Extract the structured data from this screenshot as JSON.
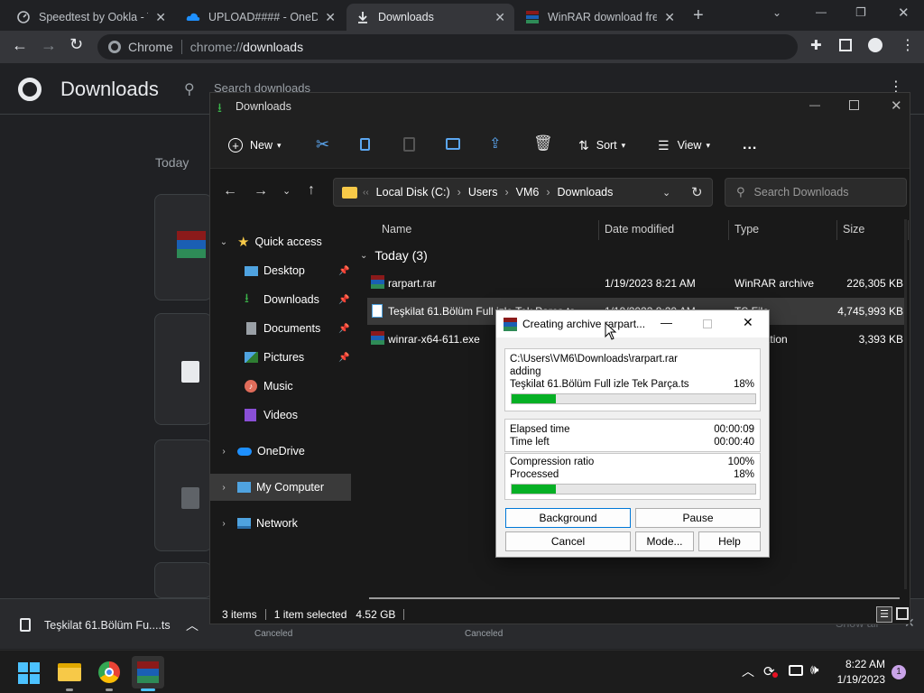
{
  "tabs": [
    {
      "title": "Speedtest by Ookla - Th",
      "icon": "speedtest-icon",
      "color": "#bdc1c6"
    },
    {
      "title": "UPLOAD#### - OneDri",
      "icon": "onedrive-icon",
      "color": "#1e90ff"
    },
    {
      "title": "Downloads",
      "icon": "download-icon",
      "color": "#e8eaed"
    },
    {
      "title": "WinRAR download free",
      "icon": "winrar-icon",
      "color": "#8b1a1a"
    }
  ],
  "omnibox": {
    "site": "Chrome",
    "url_prefix": "chrome://",
    "url_path": "downloads"
  },
  "downloads_page": {
    "title": "Downloads",
    "search_placeholder": "Search downloads",
    "section": "Today",
    "show_all": "Show all"
  },
  "shelf": {
    "file": "Teşkilat 61.Bölüm Fu....ts",
    "item1_status": "Canceled",
    "item2_status": "Canceled"
  },
  "explorer": {
    "title": "Downloads",
    "cmd": {
      "new": "New",
      "sort": "Sort",
      "view": "View",
      "more": "..."
    },
    "breadcrumb": [
      "Local Disk (C:)",
      "Users",
      "VM6",
      "Downloads"
    ],
    "search_placeholder": "Search Downloads",
    "nav": {
      "quick_access": "Quick access",
      "items": [
        "Desktop",
        "Downloads",
        "Documents",
        "Pictures",
        "Music",
        "Videos"
      ],
      "onedrive": "OneDrive",
      "my_computer": "My Computer",
      "network": "Network"
    },
    "columns": {
      "name": "Name",
      "date": "Date modified",
      "type": "Type",
      "size": "Size"
    },
    "group": "Today (3)",
    "files": [
      {
        "name": "rarpart.rar",
        "date": "1/19/2023 8:21 AM",
        "type": "WinRAR archive",
        "size": "226,305 KB"
      },
      {
        "name": "Teşkilat 61.Bölüm Full izle Tek Parça.ts",
        "date": "1/19/2023 8:20 AM",
        "type": "TS File",
        "size": "4,745,993 KB"
      },
      {
        "name": "winrar-x64-611.exe",
        "date": "",
        "type": "Application",
        "size": "3,393 KB"
      }
    ],
    "status": {
      "count": "3 items",
      "selected": "1 item selected",
      "size": "4.52 GB"
    }
  },
  "winrar": {
    "title": "Creating archive rarpart...",
    "archive_path": "C:\\Users\\VM6\\Downloads\\rarpart.rar",
    "action": "adding",
    "current_file": "Teşkilat 61.Bölüm Full izle Tek Parça.ts",
    "file_percent": "18%",
    "file_progress": 0.18,
    "elapsed_label": "Elapsed time",
    "elapsed": "00:00:09",
    "left_label": "Time left",
    "left": "00:00:40",
    "ratio_label": "Compression ratio",
    "ratio": "100%",
    "processed_label": "Processed",
    "processed": "18%",
    "processed_progress": 0.18,
    "buttons": {
      "background": "Background",
      "pause": "Pause",
      "cancel": "Cancel",
      "mode": "Mode...",
      "help": "Help"
    }
  },
  "taskbar": {
    "time": "8:22 AM",
    "date": "1/19/2023",
    "notifications": "1"
  }
}
